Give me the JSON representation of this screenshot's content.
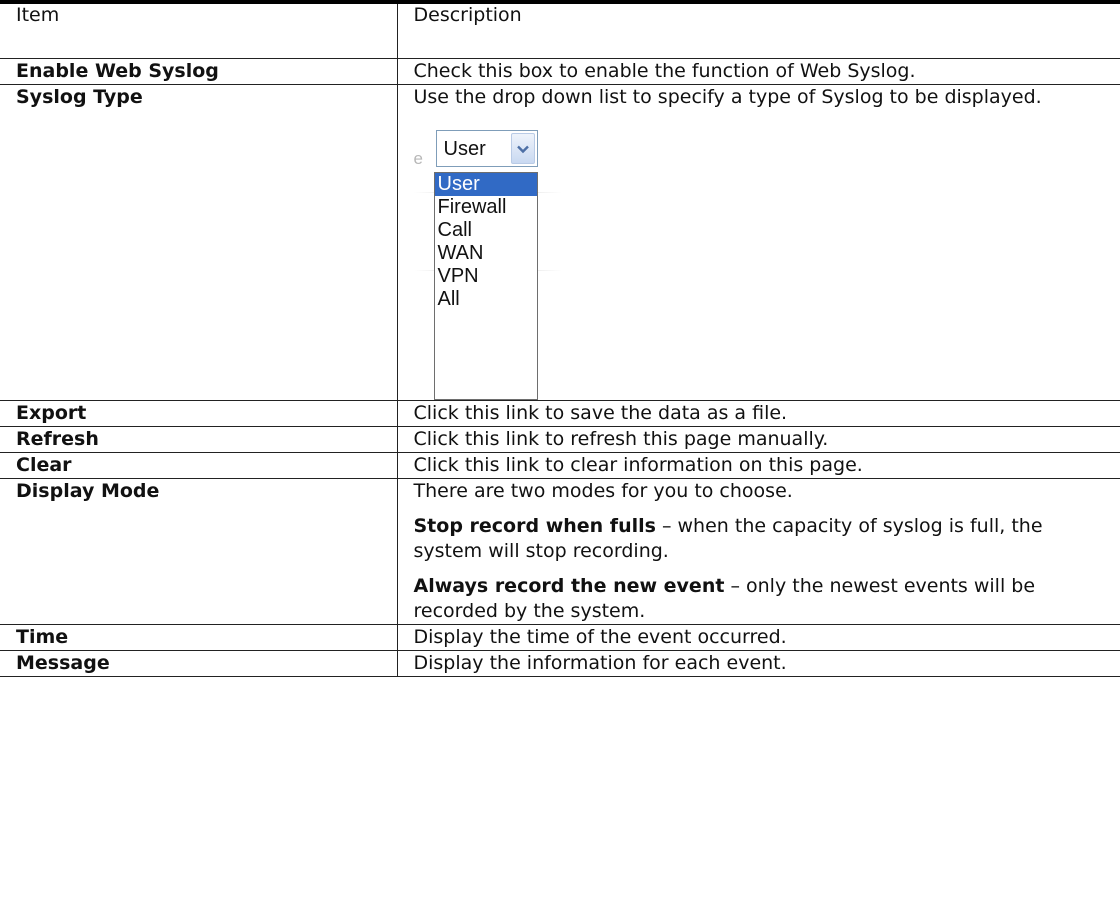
{
  "header": {
    "item": "Item",
    "description": "Description"
  },
  "rows": [
    {
      "item": "Enable Web Syslog",
      "paragraphs": [
        {
          "lead": "",
          "text": "Check this box to enable the function of Web Syslog."
        }
      ]
    },
    {
      "item": "Syslog Type",
      "paragraphs": [
        {
          "lead": "",
          "text": "Use the drop down list to specify a type of Syslog to be displayed."
        }
      ]
    },
    {
      "item": "Export",
      "paragraphs": [
        {
          "lead": "",
          "text": "Click this link to save the data as a file."
        }
      ]
    },
    {
      "item": "Refresh",
      "paragraphs": [
        {
          "lead": "",
          "text": "Click this link to refresh this page manually."
        }
      ]
    },
    {
      "item": "Clear",
      "paragraphs": [
        {
          "lead": "",
          "text": "Click this link to clear information on this page."
        }
      ]
    },
    {
      "item": "Display Mode",
      "paragraphs": [
        {
          "lead": "",
          "text": "There are two modes for you to choose."
        },
        {
          "lead": "Stop record when fulls",
          "text": " – when the capacity of syslog is full, the system will stop recording."
        },
        {
          "lead": "Always record the new event",
          "text": " – only the newest events will be recorded by the system."
        }
      ]
    },
    {
      "item": "Time",
      "paragraphs": [
        {
          "lead": "",
          "text": "Display the time of the event occurred."
        }
      ]
    },
    {
      "item": "Message",
      "paragraphs": [
        {
          "lead": "",
          "text": "Display the information for each event."
        }
      ]
    }
  ],
  "dropdown": {
    "ghost_letter": "e",
    "selected": "User",
    "options": [
      "User",
      "Firewall",
      "Call",
      "WAN",
      "VPN",
      "All"
    ],
    "highlighted_index": 0,
    "arrow_icon": "chevron-down-icon",
    "highlight_color": "#316ac5"
  }
}
